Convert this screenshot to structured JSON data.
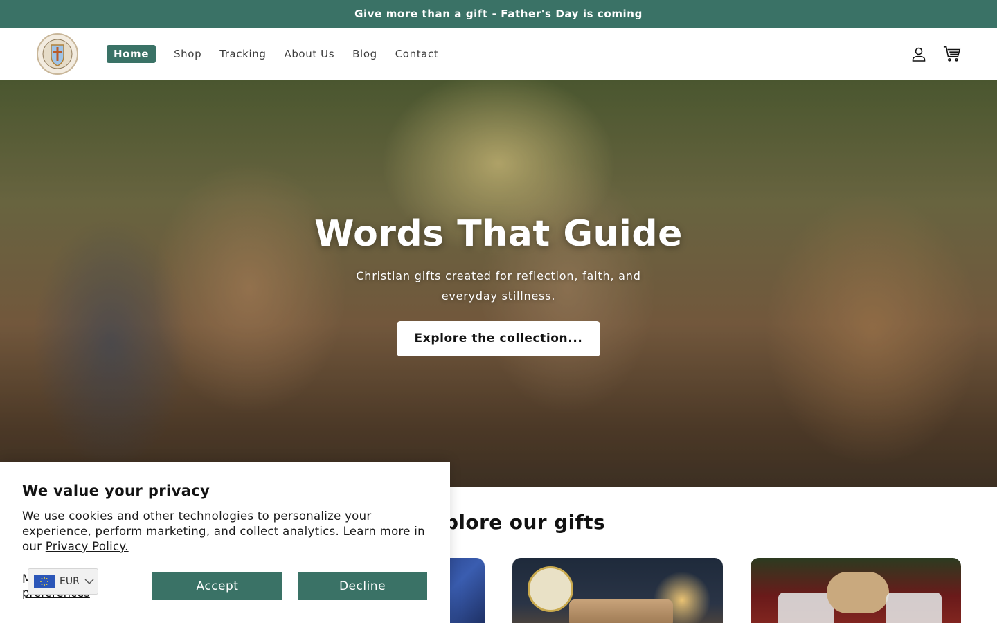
{
  "announcement": "Give more than a gift - Father's Day is coming",
  "header": {
    "nav": [
      {
        "label": "Home"
      },
      {
        "label": "Shop"
      },
      {
        "label": "Tracking"
      },
      {
        "label": "About Us"
      },
      {
        "label": "Blog"
      },
      {
        "label": "Contact"
      }
    ],
    "icons": [
      "account-icon",
      "cart-icon"
    ]
  },
  "hero": {
    "title": "Words That Guide",
    "subtitle": "Christian gifts created for reflection, faith, and everyday stillness.",
    "button": "Explore the collection..."
  },
  "section": {
    "title": "Explore our gifts"
  },
  "cookie": {
    "title": "We value your privacy",
    "text": "We use cookies and other technologies to personalize your experience, perform marketing, and collect analytics. Learn more in our ",
    "link": "Privacy Policy.",
    "manage": "Manage preferences",
    "accept": "Accept",
    "decline": "Decline"
  },
  "currency": {
    "code": "EUR"
  },
  "colors": {
    "brand": "#3a7266"
  }
}
